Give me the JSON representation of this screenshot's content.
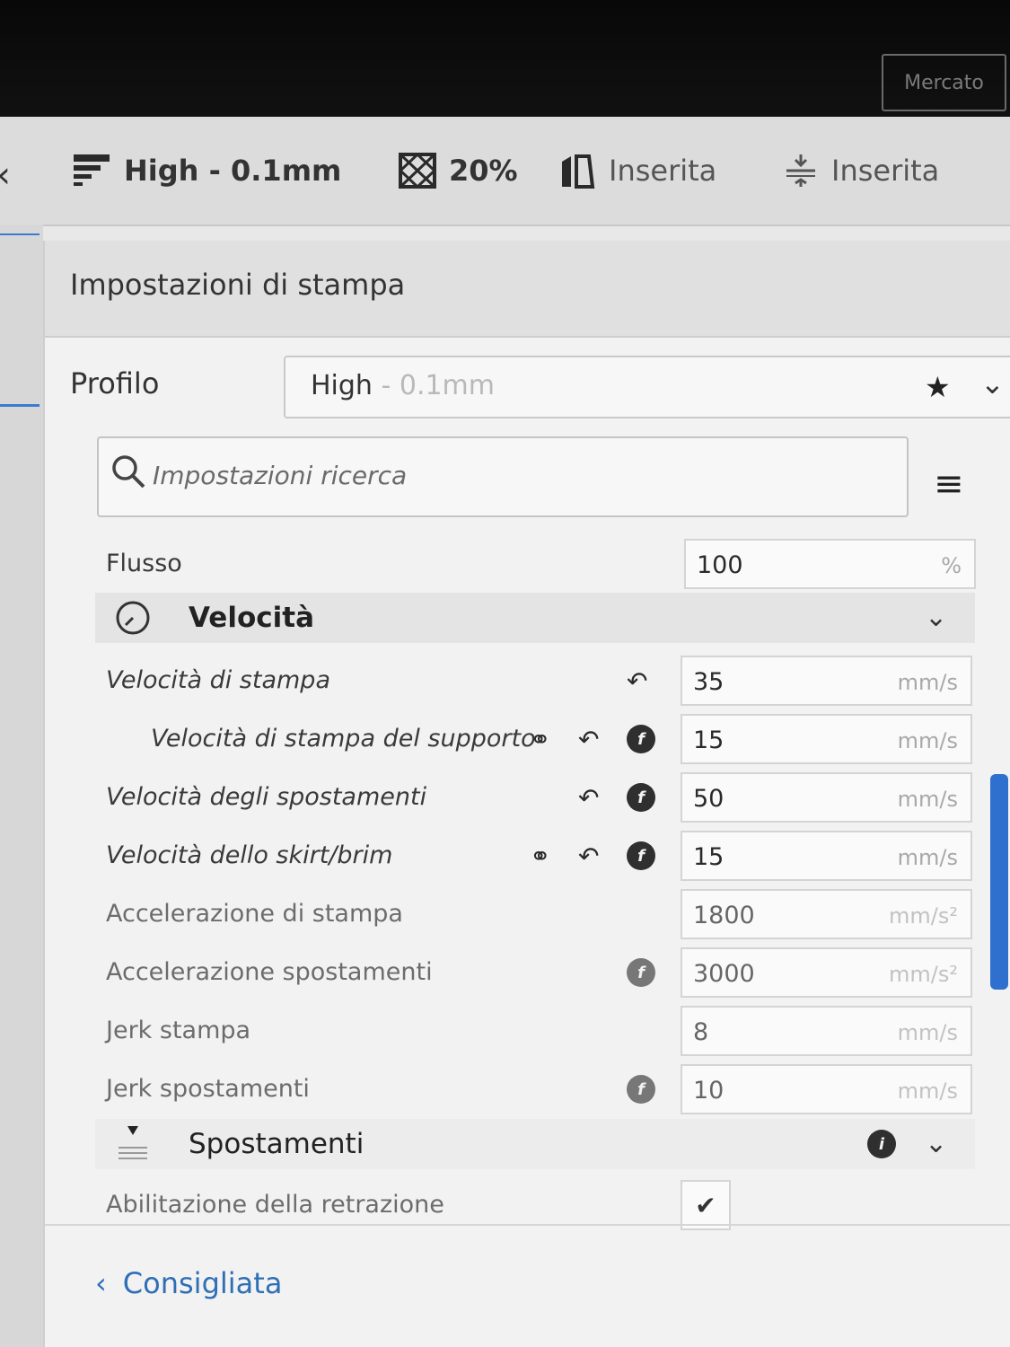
{
  "window": {
    "marketplace_label": "Mercato"
  },
  "toolbar": {
    "profile": "High - 0.1mm",
    "infill": "20%",
    "support": "Inserita",
    "adhesion": "Inserita"
  },
  "panel": {
    "title": "Impostazioni di stampa",
    "profile_label": "Profilo",
    "profile_name": "High",
    "profile_detail": " - 0.1mm",
    "search_placeholder": "Impostazioni ricerca"
  },
  "settings": {
    "flow": {
      "label": "Flusso",
      "value": "100",
      "unit": "%"
    },
    "speed_section": {
      "title": "Velocità"
    },
    "print_speed": {
      "label": "Velocità di stampa",
      "value": "35",
      "unit": "mm/s"
    },
    "support_speed": {
      "label": "Velocità di stampa del supporto",
      "value": "15",
      "unit": "mm/s"
    },
    "travel_speed": {
      "label": "Velocità degli spostamenti",
      "value": "50",
      "unit": "mm/s"
    },
    "skirt_speed": {
      "label": "Velocità dello skirt/brim",
      "value": "15",
      "unit": "mm/s"
    },
    "print_accel": {
      "label": "Accelerazione di stampa",
      "value": "1800",
      "unit": "mm/s²"
    },
    "travel_accel": {
      "label": "Accelerazione spostamenti",
      "value": "3000",
      "unit": "mm/s²"
    },
    "print_jerk": {
      "label": "Jerk stampa",
      "value": "8",
      "unit": "mm/s"
    },
    "travel_jerk": {
      "label": "Jerk spostamenti",
      "value": "10",
      "unit": "mm/s"
    },
    "travel_section": {
      "title": "Spostamenti"
    },
    "retraction": {
      "label": "Abilitazione della retrazione",
      "checked": true,
      "mark": "✔"
    }
  },
  "footer": {
    "recommended_label": "Consigliata"
  },
  "icons": {
    "link": "link-icon",
    "reset": "reset-icon",
    "fx": "function-icon",
    "star": "star-icon",
    "menu": "menu-icon",
    "chevron": "chevron-down-icon"
  },
  "colors": {
    "accent": "#2f6fb5",
    "scrollbar": "#2f6fce",
    "topbar": "#0b0b0b"
  }
}
